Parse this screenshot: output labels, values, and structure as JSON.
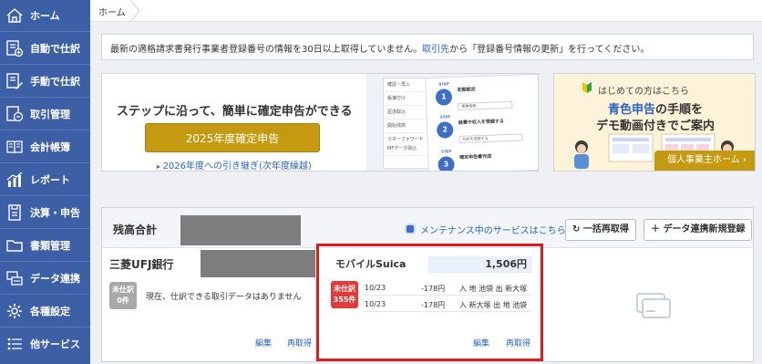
{
  "sidebar": {
    "items": [
      {
        "label": "ホーム",
        "icon": "home-icon"
      },
      {
        "label": "自動で仕訳",
        "icon": "auto-journal-icon"
      },
      {
        "label": "手動で仕訳",
        "icon": "manual-journal-icon"
      },
      {
        "label": "取引管理",
        "icon": "transaction-icon"
      },
      {
        "label": "会計帳簿",
        "icon": "ledger-icon"
      },
      {
        "label": "レポート",
        "icon": "report-icon"
      },
      {
        "label": "決算・申告",
        "icon": "tax-return-icon"
      },
      {
        "label": "書類管理",
        "icon": "folder-icon"
      },
      {
        "label": "データ連携",
        "icon": "data-link-icon"
      },
      {
        "label": "各種設定",
        "icon": "gear-icon"
      },
      {
        "label": "他サービス",
        "icon": "list-icon"
      }
    ]
  },
  "breadcrumb": {
    "home": "ホーム"
  },
  "notice": {
    "before": "最新の適格請求書発行事業者登録番号の情報を30日以上取得していません。",
    "link": "取引先",
    "after": "から「登録番号情報の更新」を行ってください。"
  },
  "promo": {
    "title": "ステップに沿って、簡単に確定申告ができる",
    "button": "2025年度確定申告",
    "link": "2026年度への引き継ぎ(次年度繰越)",
    "shot": {
      "menu": [
        "確認・再入",
        "帳簿付け",
        "証憑取込",
        "開始残高",
        "マネーフォワード",
        "MFデータ取込"
      ],
      "steps": [
        {
          "tag": "STEP",
          "num": "1",
          "text": "初期設定",
          "field": "事業情報"
        },
        {
          "tag": "STEP",
          "num": "2",
          "text": "経費や収入を登録する",
          "field": "仕訳を登録する"
        },
        {
          "tag": "STEP",
          "num": "3",
          "text": "確定申告書作成",
          "field": ""
        }
      ]
    }
  },
  "guide": {
    "top": "はじめての方はこちら",
    "line1_blue": "青色申告",
    "line1_rest": "の手順を",
    "line2": "デモ動画付きでご案内",
    "button": "個人事業主ホーム ›"
  },
  "balance": {
    "title": "残高合計",
    "maintenance": "メンテナンス中のサービスはこちら",
    "refresh_all": "一括再取得",
    "add_link": "データ連携新規登録"
  },
  "accounts": [
    {
      "name": "三菱UFJ銀行",
      "badge_line1": "未仕訳",
      "badge_line2": "0件",
      "message": "現在、仕訳できる取引データはありません",
      "edit": "編集",
      "refetch": "再取得"
    },
    {
      "name": "モバイルSuica",
      "balance": "1,506円",
      "badge_line1": "未仕訳",
      "badge_line2": "355件",
      "transactions": [
        {
          "date": "10/23",
          "amount": "-178円",
          "desc": "入 地 池袋 出 新大塚"
        },
        {
          "date": "10/23",
          "amount": "-178円",
          "desc": "入 新大塚 出 地 池袋"
        }
      ],
      "edit": "編集",
      "refetch": "再取得"
    }
  ],
  "colors": {
    "sidebar": "#3d5fa6",
    "accent_gold": "#c69a10",
    "link_blue": "#2a64c4",
    "highlight_red": "#e01b1b",
    "badge_gray": "#a8a8a8",
    "badge_red": "#e03a3a"
  }
}
